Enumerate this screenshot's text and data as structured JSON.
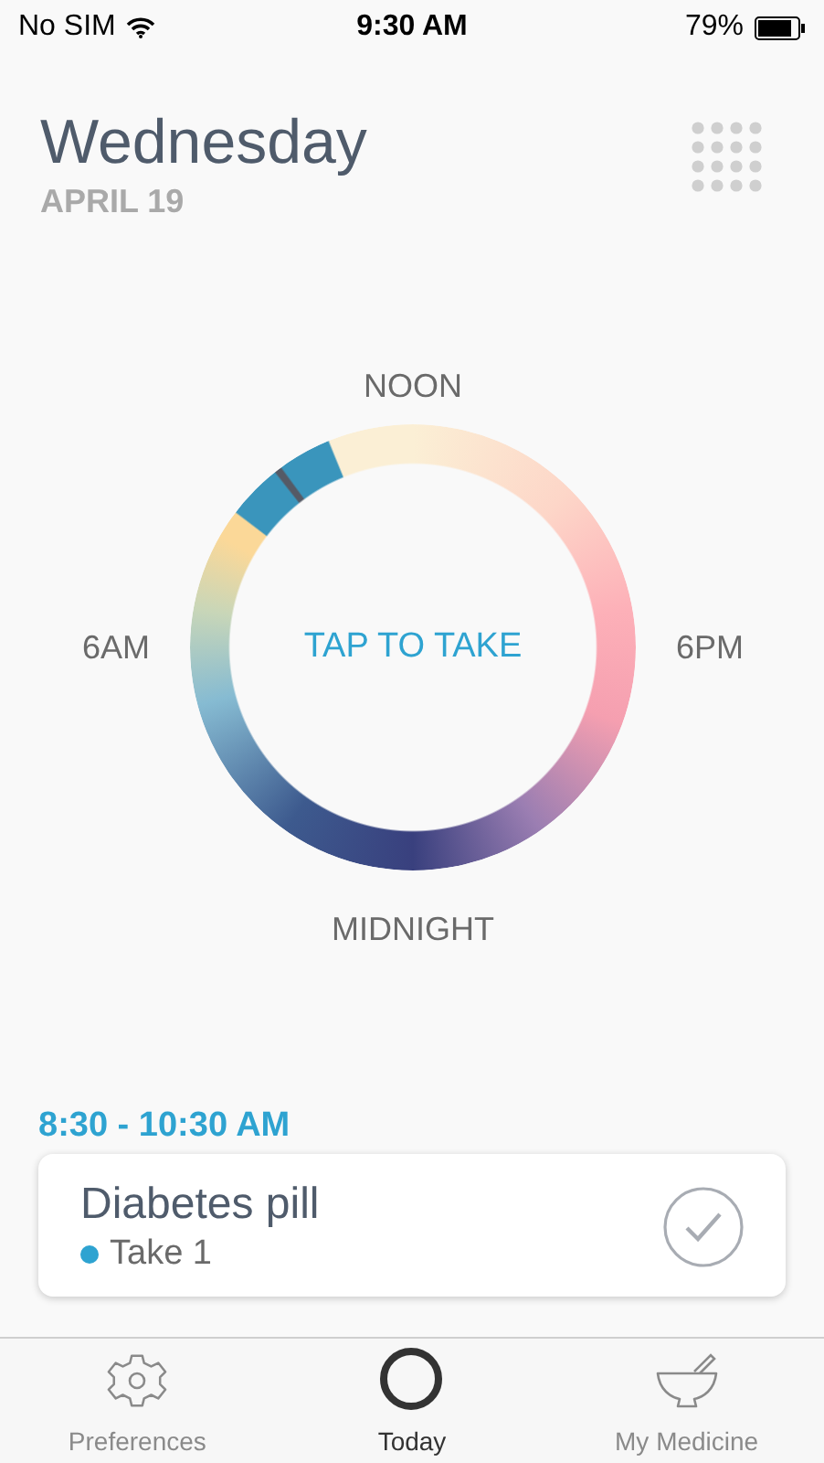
{
  "status_bar": {
    "carrier": "No SIM",
    "time": "9:30 AM",
    "battery": "79%"
  },
  "header": {
    "day": "Wednesday",
    "date": "APRIL 19"
  },
  "dial": {
    "top_label": "NOON",
    "left_label": "6AM",
    "right_label": "6PM",
    "bottom_label": "MIDNIGHT",
    "center_button": "TAP TO TAKE"
  },
  "schedule": {
    "time_range": "8:30 - 10:30 AM",
    "doses": [
      {
        "name": "Diabetes pill",
        "instruction": "Take 1",
        "color": "#2ea3d1",
        "taken": false
      }
    ]
  },
  "tabs": [
    {
      "label": "Preferences",
      "kind": "gear",
      "selected": false
    },
    {
      "label": "Today",
      "kind": "ring",
      "selected": true
    },
    {
      "label": "My Medicine",
      "kind": "mortar",
      "selected": false
    }
  ]
}
